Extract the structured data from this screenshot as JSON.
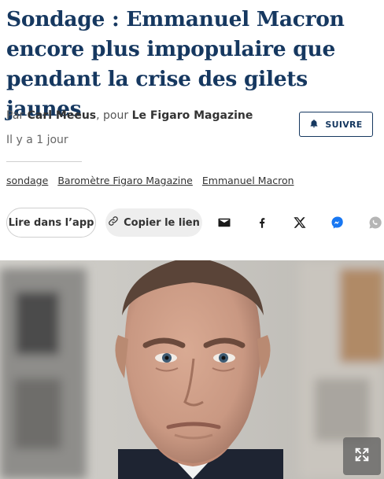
{
  "article": {
    "headline": "Sondage : Emmanuel Macron encore plus impopulaire que pendant la crise des gilets jaunes",
    "byline_prefix": "Par ",
    "author": "Carl Meeus",
    "byline_middle": ", pour ",
    "publication": "Le Figaro Magazine",
    "date": "Il y a 1 jour"
  },
  "follow": {
    "label": "SUIVRE",
    "icon": "bell-icon"
  },
  "tags": [
    "sondage",
    "Baromètre Figaro Magazine",
    "Emmanuel Macron"
  ],
  "actions": {
    "read_in_app": "Lire dans l’app",
    "copy_link": "Copier le lien",
    "share_icons": [
      "email-icon",
      "facebook-icon",
      "x-icon",
      "messenger-icon",
      "whatsapp-icon"
    ]
  },
  "hero": {
    "expand_icon": "expand-icon"
  },
  "colors": {
    "headline": "#163860",
    "accent": "#163860",
    "pill_bg": "#eeeeee",
    "messenger": "#1877f2"
  }
}
